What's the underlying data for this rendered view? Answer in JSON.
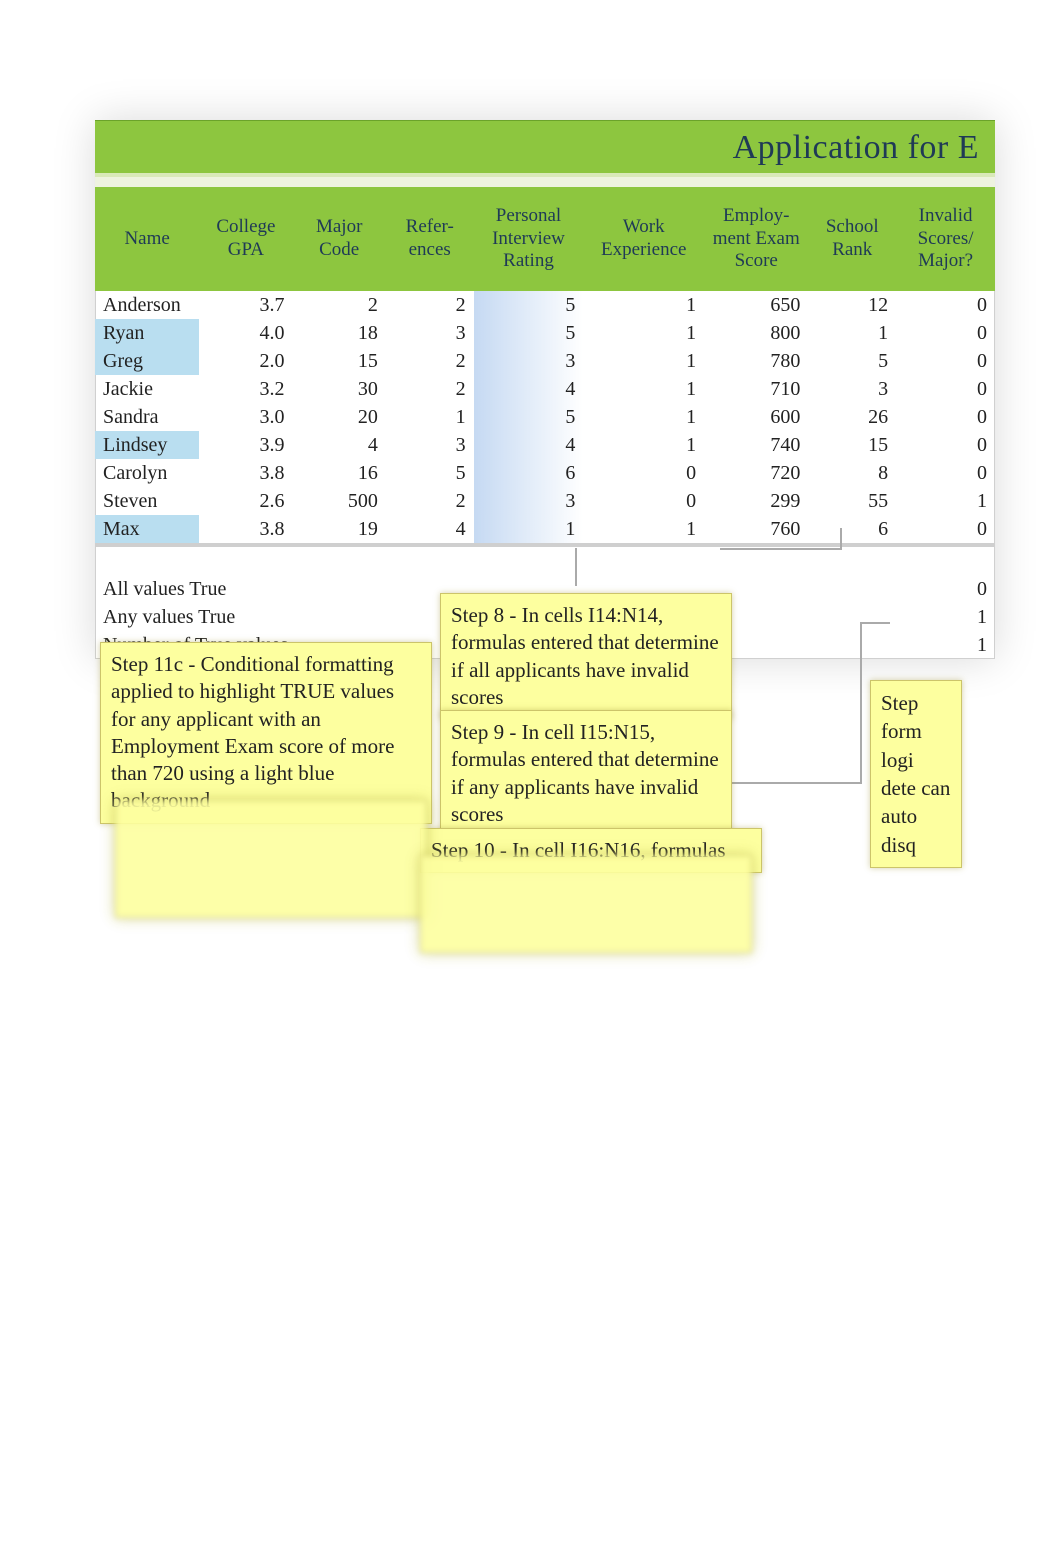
{
  "title": "Application for E",
  "columns": [
    "Name",
    "College GPA",
    "Major Code",
    "Refer-ences",
    "Personal Interview Rating",
    "Work Experience",
    "Employ-ment Exam Score",
    "School Rank",
    "Invalid Scores/ Major?"
  ],
  "rows": [
    {
      "name": "Anderson",
      "gpa": "3.7",
      "major": "2",
      "refs": "2",
      "interview": "5",
      "work": "1",
      "exam": "650",
      "rank": "12",
      "invalid": "0",
      "cf_blue": false
    },
    {
      "name": "Ryan",
      "gpa": "4.0",
      "major": "18",
      "refs": "3",
      "interview": "5",
      "work": "1",
      "exam": "800",
      "rank": "1",
      "invalid": "0",
      "cf_blue": true
    },
    {
      "name": "Greg",
      "gpa": "2.0",
      "major": "15",
      "refs": "2",
      "interview": "3",
      "work": "1",
      "exam": "780",
      "rank": "5",
      "invalid": "0",
      "cf_blue": true
    },
    {
      "name": "Jackie",
      "gpa": "3.2",
      "major": "30",
      "refs": "2",
      "interview": "4",
      "work": "1",
      "exam": "710",
      "rank": "3",
      "invalid": "0",
      "cf_blue": false
    },
    {
      "name": "Sandra",
      "gpa": "3.0",
      "major": "20",
      "refs": "1",
      "interview": "5",
      "work": "1",
      "exam": "600",
      "rank": "26",
      "invalid": "0",
      "cf_blue": false
    },
    {
      "name": "Lindsey",
      "gpa": "3.9",
      "major": "4",
      "refs": "3",
      "interview": "4",
      "work": "1",
      "exam": "740",
      "rank": "15",
      "invalid": "0",
      "cf_blue": true
    },
    {
      "name": "Carolyn",
      "gpa": "3.8",
      "major": "16",
      "refs": "5",
      "interview": "6",
      "work": "0",
      "exam": "720",
      "rank": "8",
      "invalid": "0",
      "cf_blue": false
    },
    {
      "name": "Steven",
      "gpa": "2.6",
      "major": "500",
      "refs": "2",
      "interview": "3",
      "work": "0",
      "exam": "299",
      "rank": "55",
      "invalid": "1",
      "cf_blue": false
    },
    {
      "name": "Max",
      "gpa": "3.8",
      "major": "19",
      "refs": "4",
      "interview": "1",
      "work": "1",
      "exam": "760",
      "rank": "6",
      "invalid": "0",
      "cf_blue": true
    }
  ],
  "summary": [
    {
      "label": "All values True",
      "value": "0"
    },
    {
      "label": "Any values True",
      "value": "1"
    },
    {
      "label": "Number of True values",
      "value": "1"
    }
  ],
  "callouts": {
    "step11c": "Step 11c - Conditional formatting applied to highlight TRUE values for any applicant with an Employment Exam score of more than 720 using a light blue background",
    "step8": "Step 8 - In cells I14:N14, formulas entered that determine if all applicants have invalid scores",
    "step9": "Step 9 - In cell I15:N15, formulas entered that determine if any applicants have invalid scores",
    "step10": "Step 10 - In cell I16:N16, formulas",
    "stepRight": "Step form logi dete can auto disq"
  }
}
